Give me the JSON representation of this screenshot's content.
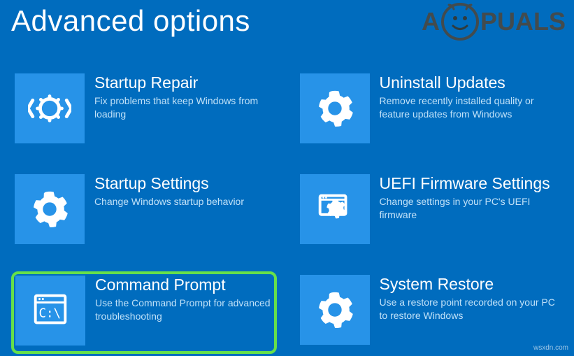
{
  "page": {
    "title": "Advanced options"
  },
  "watermark": {
    "left": "A",
    "right": "PUALS"
  },
  "credit": "wsxdn.com",
  "tiles": {
    "startup_repair": {
      "title": "Startup Repair",
      "desc": "Fix problems that keep Windows from loading"
    },
    "uninstall_updates": {
      "title": "Uninstall Updates",
      "desc": "Remove recently installed quality or feature updates from Windows"
    },
    "startup_settings": {
      "title": "Startup Settings",
      "desc": "Change Windows startup behavior"
    },
    "uefi": {
      "title": "UEFI Firmware Settings",
      "desc": "Change settings in your PC's UEFI firmware"
    },
    "cmd": {
      "title": "Command Prompt",
      "desc": "Use the Command Prompt for advanced troubleshooting"
    },
    "system_restore": {
      "title": "System Restore",
      "desc": "Use a restore point recorded on your PC to restore Windows"
    }
  }
}
